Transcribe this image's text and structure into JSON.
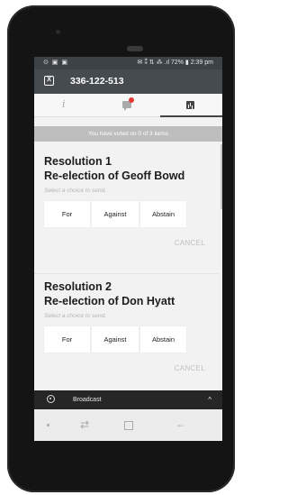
{
  "status_bar": {
    "left_icons": "⊙ ▣ ▣",
    "right_text": "✉ ⁑ ⇅ ⁂ .ıl 72% ▮ 2:39 pm"
  },
  "app_bar": {
    "logo_text": "Ⅹ",
    "title": "336-122-513"
  },
  "tabs": [
    {
      "icon": "info-icon",
      "label": "i"
    },
    {
      "icon": "chat-icon"
    },
    {
      "icon": "chart-icon",
      "active": true
    }
  ],
  "vote_status": "You have voted on 0 of 3 items",
  "resolutions": [
    {
      "title": "Resolution 1",
      "subtitle": "Re-election of Geoff Bowd",
      "hint": "Select a choice to send.",
      "choices": [
        "For",
        "Against",
        "Abstain"
      ],
      "cancel": "CANCEL"
    },
    {
      "title": "Resolution 2",
      "subtitle": "Re-election of Don Hyatt",
      "hint": "Select a choice to send.",
      "choices": [
        "For",
        "Against",
        "Abstain"
      ],
      "cancel": "CANCEL"
    }
  ],
  "broadcast": {
    "label": "Broadcast",
    "chevron": "^"
  },
  "nav": {
    "switch_glyph": "⇄",
    "back_glyph": "←"
  },
  "colors": {
    "app_bar": "#454b4f",
    "status_bar": "#3c4246",
    "vote_banner": "#bdbdbd",
    "broadcast_bar": "#262626",
    "notification_dot": "#e53935"
  }
}
